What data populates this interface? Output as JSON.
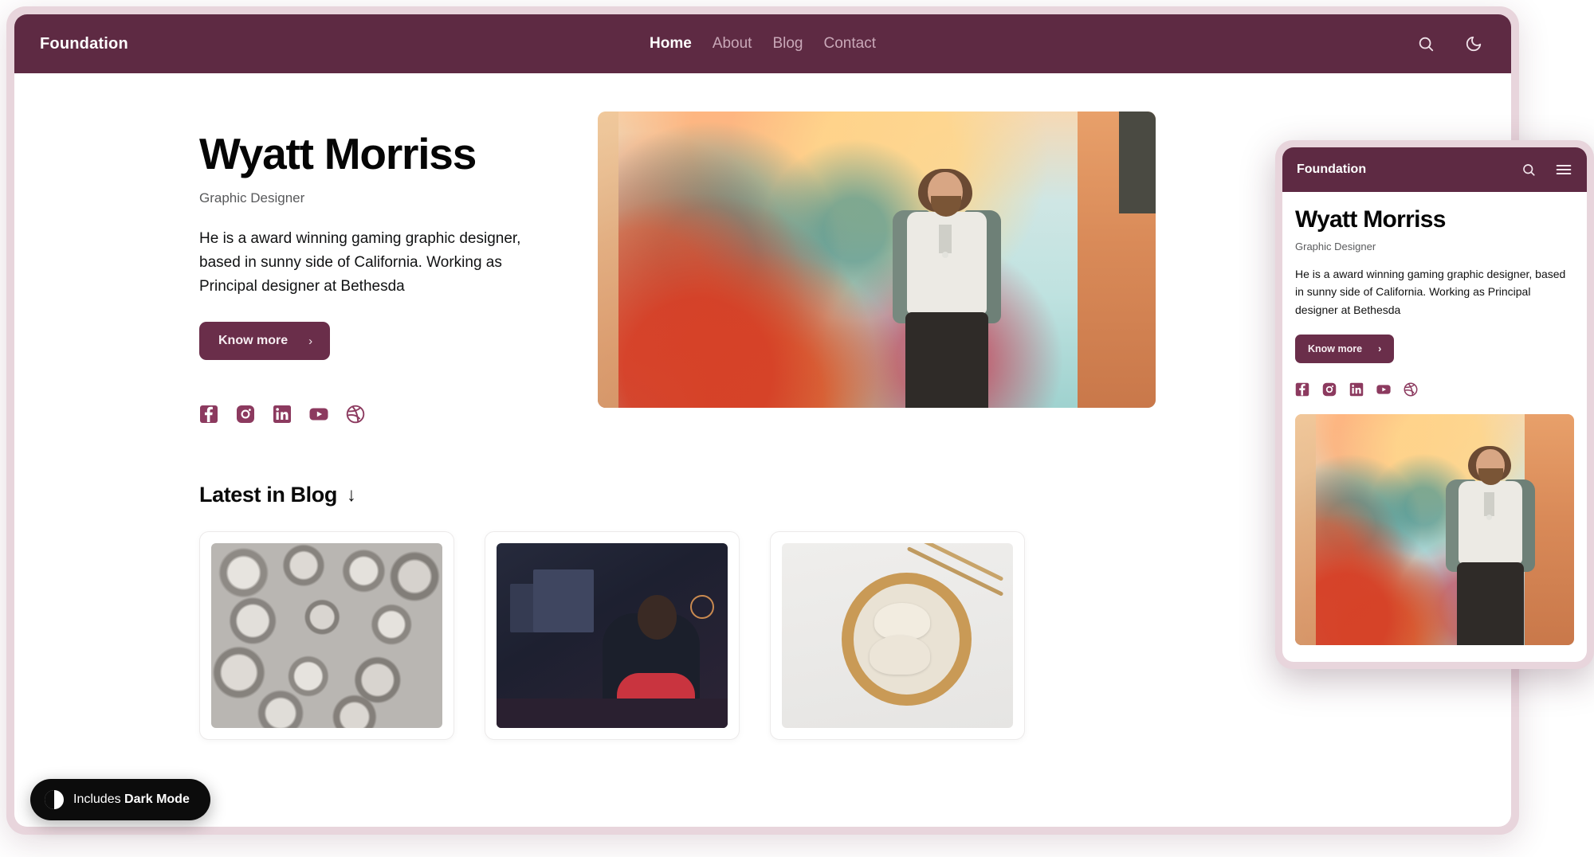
{
  "theme": {
    "brand_color": "#5e2a43",
    "button_color": "#6a2e4a",
    "frame_color": "#e8d5dc",
    "accent_social": "#8c3a5f",
    "badge_bg": "#0c0c0c"
  },
  "desktop": {
    "nav": {
      "brand": "Foundation",
      "links": [
        {
          "label": "Home",
          "active": true
        },
        {
          "label": "About",
          "active": false
        },
        {
          "label": "Blog",
          "active": false
        },
        {
          "label": "Contact",
          "active": false
        }
      ],
      "search_icon": "search-icon",
      "theme_toggle_icon": "moon-icon"
    },
    "hero": {
      "name": "Wyatt Morriss",
      "role": "Graphic Designer",
      "description": "He is a award winning gaming graphic designer, based in sunny side of California. Working as Principal designer at Bethesda",
      "cta_label": "Know more",
      "cta_chevron": "›",
      "socials": [
        {
          "name": "facebook",
          "label": "Facebook"
        },
        {
          "name": "instagram",
          "label": "Instagram"
        },
        {
          "name": "linkedin",
          "label": "LinkedIn"
        },
        {
          "name": "youtube",
          "label": "YouTube"
        },
        {
          "name": "dribbble",
          "label": "Dribbble"
        }
      ],
      "image_alt": "Man standing in front of colorful painted mural"
    },
    "blog": {
      "heading_prefix": "Latest in ",
      "heading_strong": "Blog",
      "heading_arrow": "↓",
      "cards": [
        {
          "thumb": "carved-stone-faces"
        },
        {
          "thumb": "person-at-desk-with-laptops"
        },
        {
          "thumb": "dumplings-in-wooden-bowl"
        }
      ]
    },
    "dark_mode_badge": {
      "prefix": "Includes ",
      "strong": "Dark Mode",
      "icon": "half-circle-icon"
    }
  },
  "mobile": {
    "nav": {
      "brand": "Foundation",
      "search_icon": "search-icon",
      "menu_icon": "hamburger-menu-icon"
    },
    "hero": {
      "name": "Wyatt Morriss",
      "role": "Graphic Designer",
      "description": "He is a award winning gaming graphic designer, based in sunny side of California. Working as Principal designer at Bethesda",
      "cta_label": "Know more",
      "cta_chevron": "›",
      "socials": [
        {
          "name": "facebook",
          "label": "Facebook"
        },
        {
          "name": "instagram",
          "label": "Instagram"
        },
        {
          "name": "linkedin",
          "label": "LinkedIn"
        },
        {
          "name": "youtube",
          "label": "YouTube"
        },
        {
          "name": "dribbble",
          "label": "Dribbble"
        }
      ],
      "image_alt": "Man standing in front of colorful painted mural"
    }
  }
}
